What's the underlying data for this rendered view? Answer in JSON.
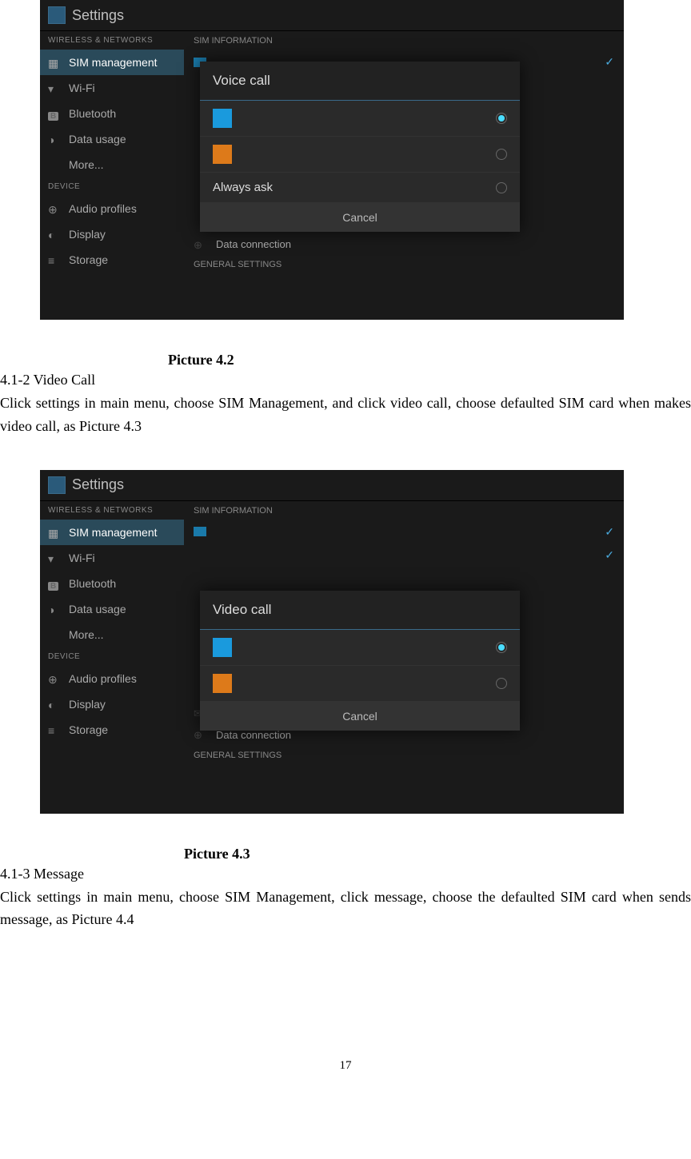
{
  "figure1": {
    "app_title": "Settings",
    "sidebar": {
      "section1": "WIRELESS & NETWORKS",
      "sim": "SIM management",
      "wifi": "Wi-Fi",
      "bt": "Bluetooth",
      "data": "Data usage",
      "more": "More...",
      "section2": "DEVICE",
      "audio": "Audio profiles",
      "display": "Display",
      "storage": "Storage"
    },
    "main": {
      "sim_info": "SIM INFORMATION",
      "data_conn": "Data connection",
      "general": "GENERAL SETTINGS"
    },
    "dialog": {
      "title": "Voice call",
      "always": "Always ask",
      "cancel": "Cancel"
    }
  },
  "caption1": "Picture 4.2",
  "section1_heading": "4.1-2 Video Call",
  "section1_body": "Click settings in main menu, choose SIM Management, and click video call, choose defaulted SIM card when makes video call, as Picture 4.3",
  "figure2": {
    "app_title": "Settings",
    "sidebar": {
      "section1": "WIRELESS & NETWORKS",
      "sim": "SIM management",
      "wifi": "Wi-Fi",
      "bt": "Bluetooth",
      "data": "Data usage",
      "more": "More...",
      "section2": "DEVICE",
      "audio": "Audio profiles",
      "display": "Display",
      "storage": "Storage"
    },
    "main": {
      "sim_info": "SIM INFORMATION",
      "messaging": "Messaging",
      "data_conn": "Data connection",
      "general": "GENERAL SETTINGS"
    },
    "dialog": {
      "title": "Video call",
      "cancel": "Cancel"
    }
  },
  "caption2": "Picture 4.3",
  "section2_heading": "4.1-3 Message",
  "section2_body": "Click settings in main menu, choose SIM Management, click message, choose the defaulted SIM card when sends message, as Picture 4.4",
  "page_number": "17"
}
